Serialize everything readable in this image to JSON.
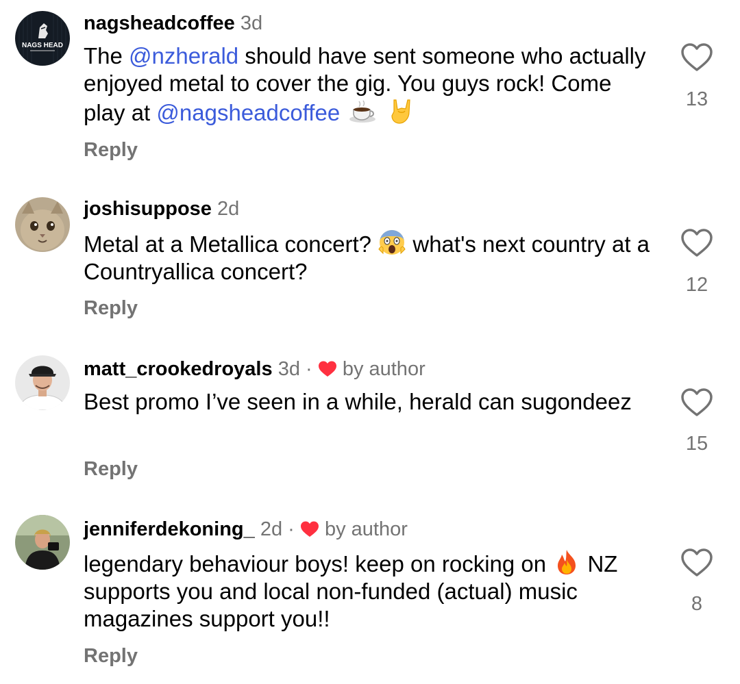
{
  "comments": [
    {
      "username": "nagsheadcoffee",
      "time": "3d",
      "author_liked": false,
      "text": {
        "p1": "The ",
        "mention1": "@nzherald",
        "p2": " should have sent someone who actually enjoyed metal to cover the gig. You guys rock! Come play at ",
        "mention2": "@nagsheadcoffee",
        "emojis": [
          "coffee-emoji",
          "rock-hand-emoji"
        ]
      },
      "avatar_logo_text": "NAGS HEAD",
      "reply_label": "Reply",
      "likes": "13"
    },
    {
      "username": "joshisuppose",
      "time": "2d",
      "author_liked": false,
      "text": {
        "p1": "Metal at a Metallica concert? ",
        "emoji": "screaming-face-emoji",
        "p2": " what's next country at a Countryallica concert?"
      },
      "reply_label": "Reply",
      "likes": "12"
    },
    {
      "username": "matt_crookedroyals",
      "time": "3d",
      "separator": "·",
      "author_liked": true,
      "author_label": "by author",
      "text": {
        "p1": "Best promo I’ve seen in a while, herald can sugondeez"
      },
      "reply_label": "Reply",
      "likes": "15"
    },
    {
      "username": "jenniferdekoning_",
      "time": "2d",
      "separator": "·",
      "author_liked": true,
      "author_label": "by author",
      "text": {
        "p1": "legendary behaviour boys! keep on rocking on ",
        "emoji": "fire-emoji",
        "p2": " NZ supports you and local non-funded (actual) music magazines support you!!"
      },
      "reply_label": "Reply",
      "likes": "8"
    }
  ],
  "colors": {
    "mention": "#3b5bdb",
    "meta": "#737373",
    "heart_red": "#ff3040"
  }
}
